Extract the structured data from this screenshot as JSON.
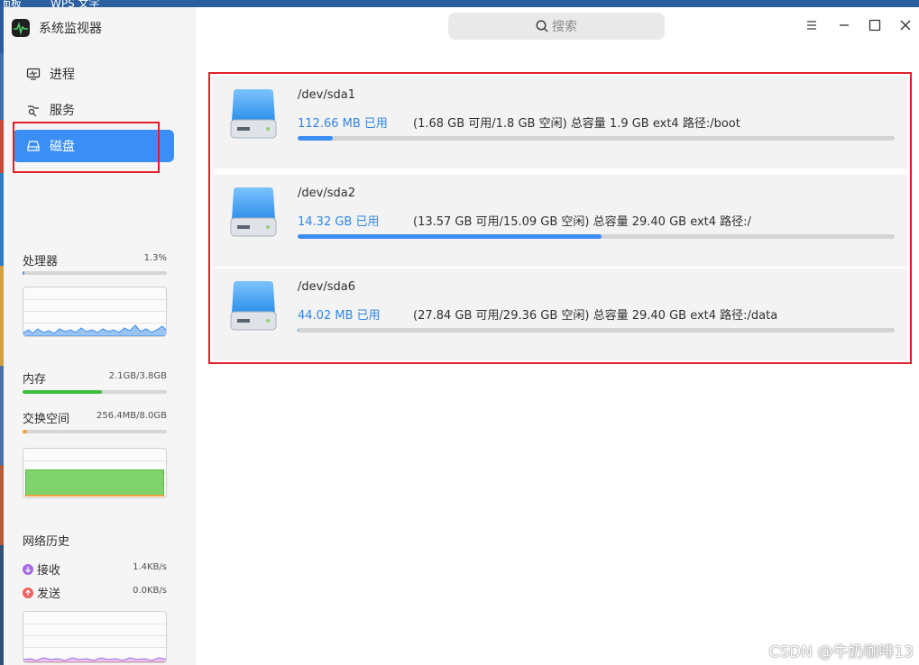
{
  "desktop": {
    "top_text_1": "面板",
    "top_text_2": "WPS 文字"
  },
  "app": {
    "title": "系统监视器"
  },
  "nav": {
    "items": [
      {
        "label": "进程",
        "icon": "monitor-icon"
      },
      {
        "label": "服务",
        "icon": "service-icon"
      },
      {
        "label": "磁盘",
        "icon": "disk-icon",
        "active": true
      }
    ]
  },
  "cpu": {
    "label": "处理器",
    "value": "1.3%",
    "percent": 1.3,
    "bar_color": "#3a8ef5"
  },
  "memory": {
    "label": "内存",
    "value": "2.1GB/3.8GB",
    "fraction": 0.55,
    "bar_color": "#3cbf3c"
  },
  "swap": {
    "label": "交换空间",
    "value": "256.4MB/8.0GB",
    "fraction": 0.03,
    "bar_color": "#f0a040",
    "graph_color": "#7ed46a"
  },
  "network": {
    "label": "网络历史",
    "receive": {
      "label": "接收",
      "value": "1.4KB/s",
      "color": "#a66be0"
    },
    "send": {
      "label": "发送",
      "value": "0.0KB/s",
      "color": "#f06060"
    }
  },
  "search": {
    "placeholder": "搜索"
  },
  "disks": [
    {
      "name": "/dev/sda1",
      "used": "112.66 MB 已用",
      "detail": "(1.68 GB 可用/1.8 GB 空闲)  总容量 1.9 GB  ext4  路径:/boot",
      "usage_fraction": 0.059
    },
    {
      "name": "/dev/sda2",
      "used": "14.32 GB 已用",
      "detail": "(13.57 GB 可用/15.09 GB 空闲)  总容量 29.40 GB  ext4  路径:/",
      "usage_fraction": 0.509
    },
    {
      "name": "/dev/sda6",
      "used": "44.02 MB 已用",
      "detail": "(27.84 GB 可用/29.36 GB 空闲)  总容量 29.40 GB  ext4  路径:/data",
      "usage_fraction": 0.0015
    }
  ],
  "accent_color": "#3a8ef5",
  "highlight_color": "#e0202a",
  "watermark": "CSDN @牛奶咖啡13"
}
